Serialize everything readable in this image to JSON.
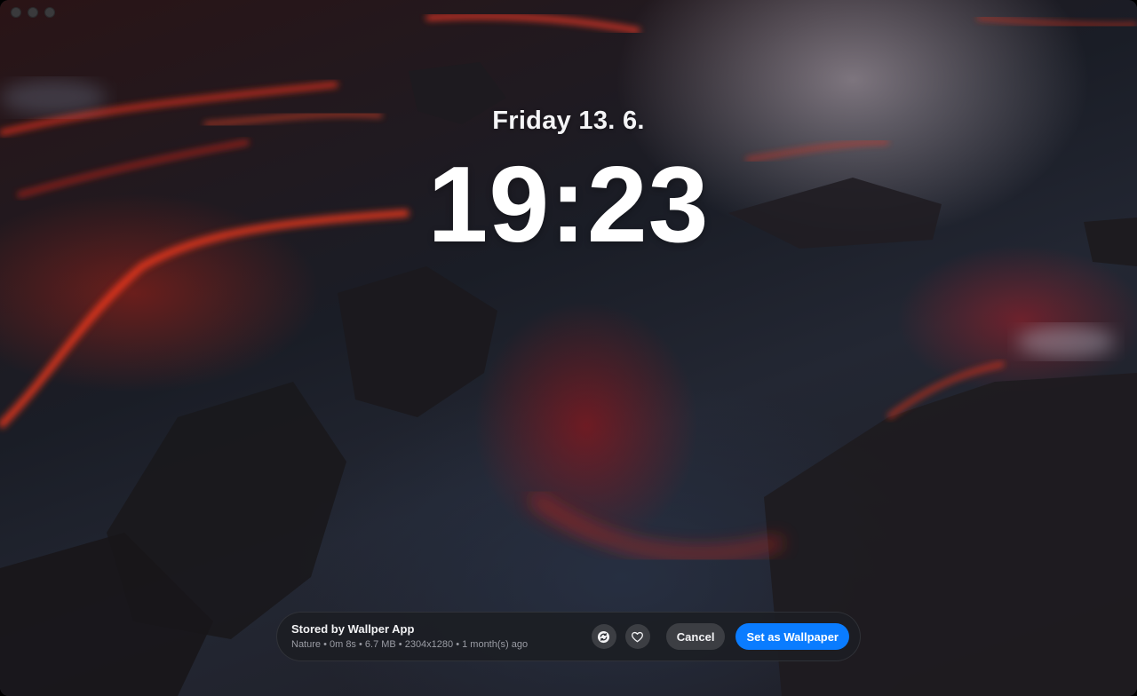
{
  "wallpaper": {
    "subject": "lava-flow",
    "accent_red": "#e0301e",
    "rock_dark": "#1f1c22",
    "water": "#2a3140"
  },
  "window": {
    "traffic_lights": [
      "close",
      "minimize",
      "zoom"
    ]
  },
  "lock_screen": {
    "date": "Friday 13. 6.",
    "time": "19:23"
  },
  "info_bar": {
    "title": "Stored by Wallper App",
    "meta": "Nature • 0m 8s • 6.7 MB • 2304x1280 • 1 month(s) ago",
    "refresh_icon": "arrow-cycle-icon",
    "favorite_icon": "heart-icon",
    "cancel_label": "Cancel",
    "set_label": "Set as Wallpaper",
    "primary_color": "#0a7cff"
  }
}
